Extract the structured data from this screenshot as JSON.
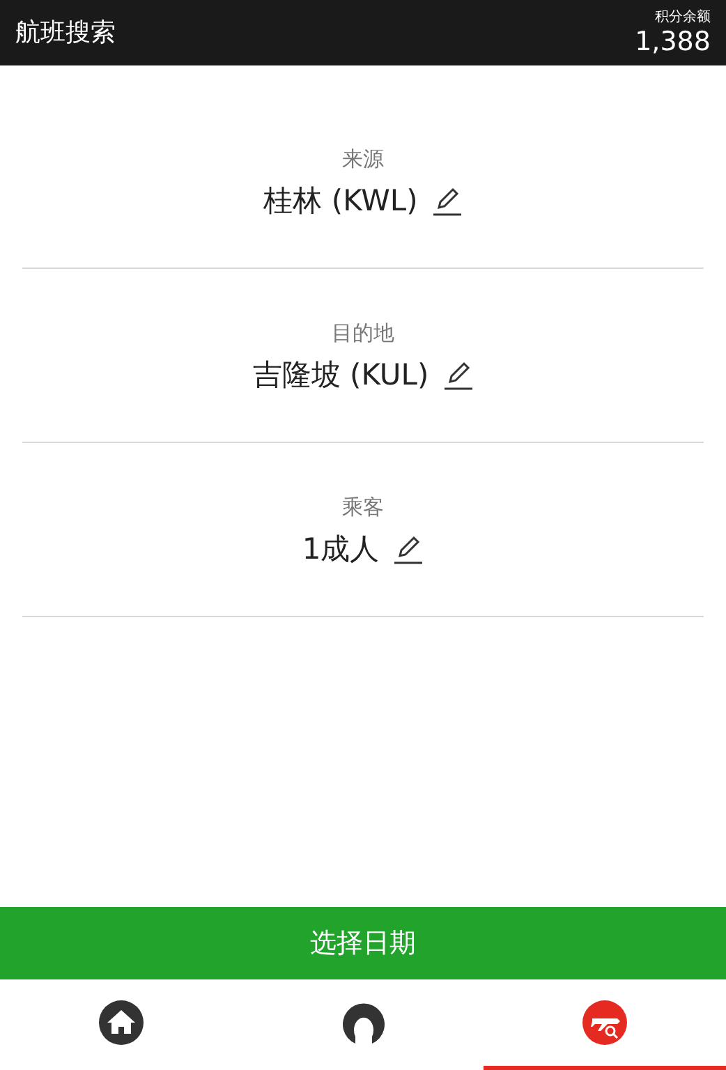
{
  "header": {
    "title": "航班搜索",
    "points_label": "积分余额",
    "points": "1,388"
  },
  "fields": [
    {
      "label": "来源",
      "value": "桂林 (KWL)"
    },
    {
      "label": "目的地",
      "value": "吉隆坡 (KUL)"
    },
    {
      "label": "乘客",
      "value": "1成人"
    }
  ],
  "action_button": "选择日期",
  "nav": [
    {
      "kind": "home",
      "selected": false
    },
    {
      "kind": "profile",
      "selected": false
    },
    {
      "kind": "flight-search",
      "selected": true
    }
  ]
}
